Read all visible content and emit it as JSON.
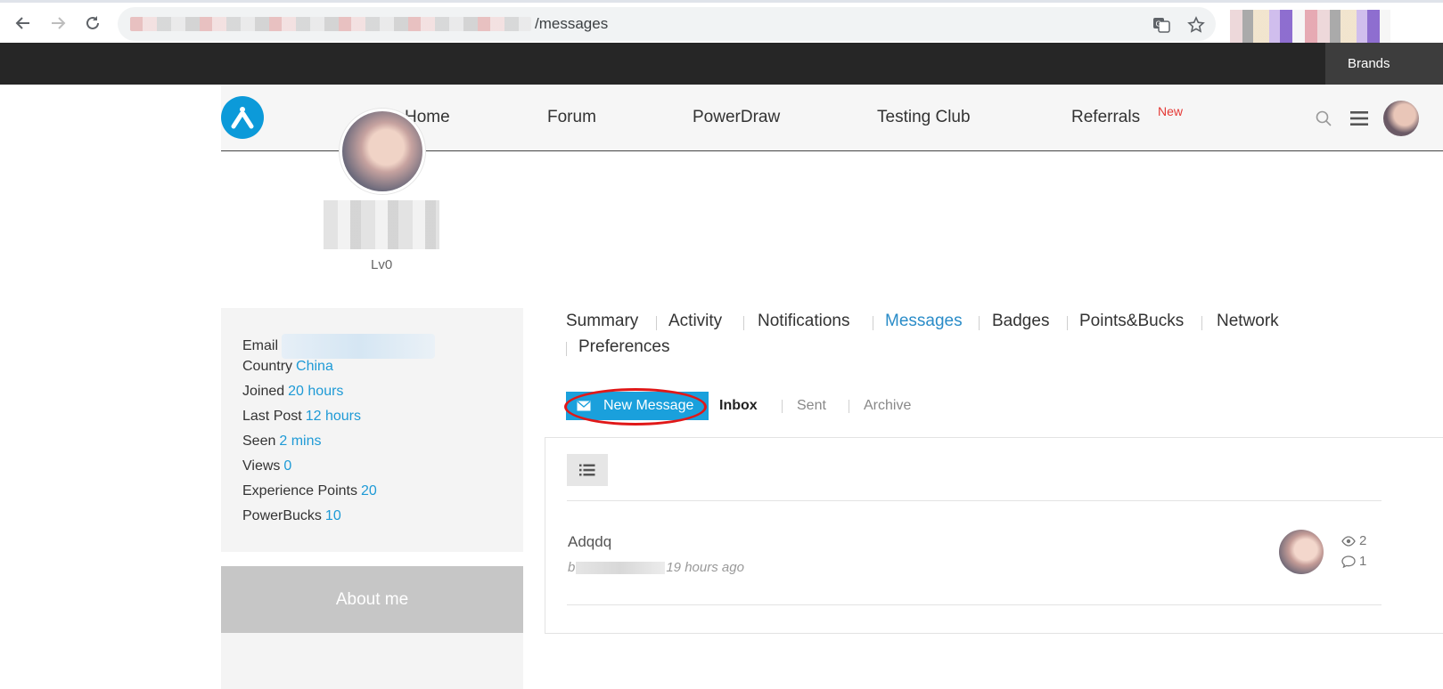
{
  "browser": {
    "url_visible": "/messages"
  },
  "topbar": {
    "brands_label": "Brands"
  },
  "header": {
    "nav": [
      "Home",
      "Forum",
      "PowerDraw",
      "Testing Club",
      "Referrals"
    ],
    "referrals_badge": "New"
  },
  "profile": {
    "level": "Lv0"
  },
  "info": {
    "email_label": "Email",
    "country_label": "Country",
    "country_value": "China",
    "joined_label": "Joined",
    "joined_value": "20 hours",
    "last_post_label": "Last Post",
    "last_post_value": "12 hours",
    "seen_label": "Seen",
    "seen_value": "2 mins",
    "views_label": "Views",
    "views_value": "0",
    "xp_label": "Experience Points",
    "xp_value": "20",
    "powerbucks_label": "PowerBucks",
    "powerbucks_value": "10"
  },
  "about_me": "About me",
  "tabs": [
    "Summary",
    "Activity",
    "Notifications",
    "Messages",
    "Badges",
    "Points&Bucks",
    "Network",
    "Preferences"
  ],
  "active_tab": "Messages",
  "messages": {
    "new_message_label": "New Message",
    "boxes": [
      "Inbox",
      "Sent",
      "Archive"
    ],
    "items": [
      {
        "title": "Adqdq",
        "by_prefix": "b",
        "time": "19 hours ago",
        "views": "2",
        "replies": "1"
      }
    ]
  },
  "colors": {
    "accent": "#1aa0dc",
    "link": "#1e9ad6",
    "highlight": "#e01818",
    "new_badge": "#e53935"
  }
}
